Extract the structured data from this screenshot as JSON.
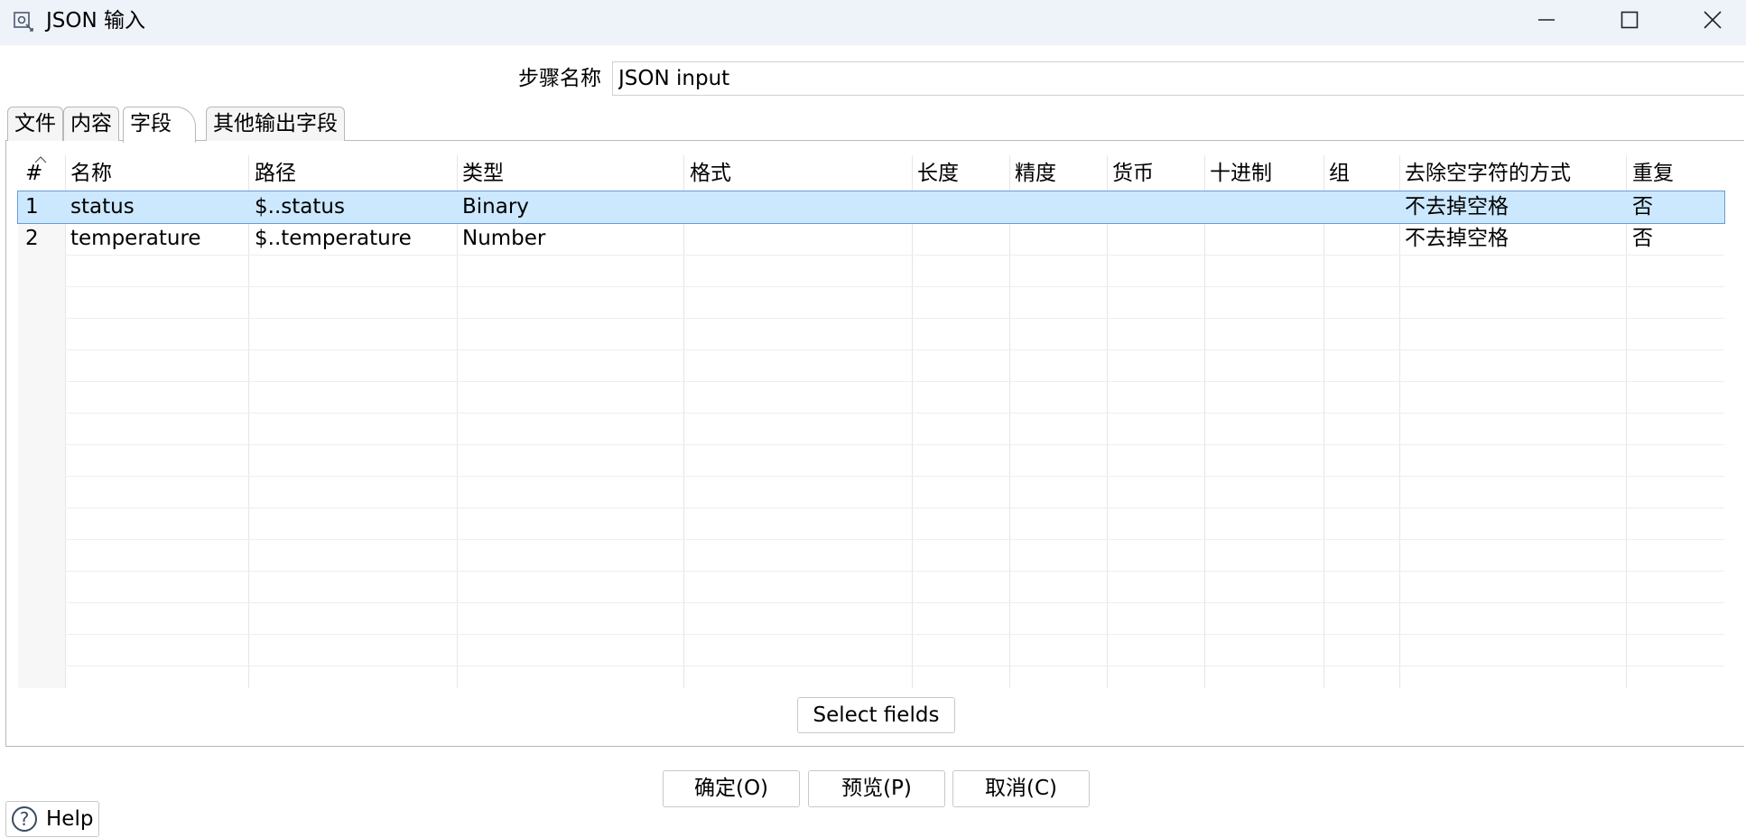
{
  "window": {
    "title": "JSON 输入",
    "controls": {
      "minimize": "minimize",
      "maximize": "maximize",
      "close": "close"
    }
  },
  "step": {
    "label": "步骤名称",
    "value": "JSON input"
  },
  "tabs": [
    {
      "label": "文件"
    },
    {
      "label": "内容"
    },
    {
      "label": "字段",
      "active": true
    },
    {
      "label": "其他输出字段"
    }
  ],
  "table": {
    "columns": [
      "#",
      "名称",
      "路径",
      "类型",
      "格式",
      "长度",
      "精度",
      "货币",
      "十进制",
      "组",
      "去除空字符的方式",
      "重复"
    ],
    "rows": [
      {
        "num": "1",
        "name": "status",
        "path": "$..status",
        "type": "Binary",
        "format": "",
        "length": "",
        "precision": "",
        "currency": "",
        "decimal": "",
        "group": "",
        "trim": "不去掉空格",
        "repeat": "否",
        "selected": true
      },
      {
        "num": "2",
        "name": "temperature",
        "path": "$..temperature",
        "type": "Number",
        "format": "",
        "length": "",
        "precision": "",
        "currency": "",
        "decimal": "",
        "group": "",
        "trim": "不去掉空格",
        "repeat": "否",
        "selected": false
      }
    ]
  },
  "select_fields_label": "Select fields",
  "buttons": {
    "ok": "确定(O)",
    "preview": "预览(P)",
    "cancel": "取消(C)"
  },
  "help": {
    "label": "Help"
  },
  "colors": {
    "titlebar": "#eef2f9",
    "selection": "#cce8ff",
    "selection_border": "#6a9bd8"
  }
}
